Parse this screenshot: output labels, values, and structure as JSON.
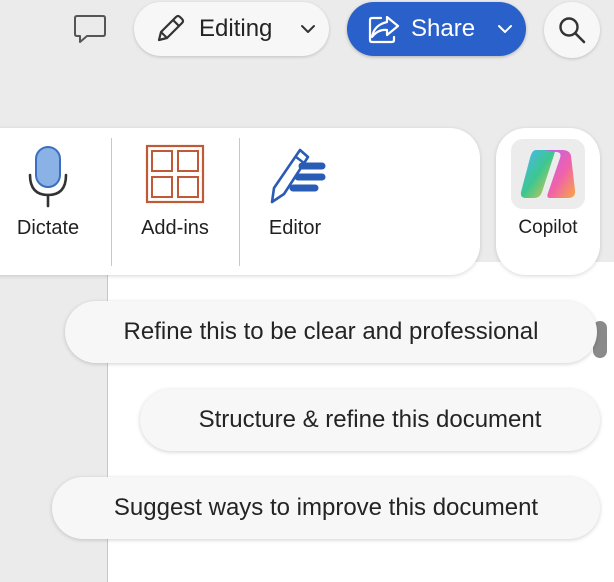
{
  "toolbar": {
    "comment_icon": "comment-icon",
    "editing_label": "Editing",
    "editing_icon": "pencil-icon",
    "share_label": "Share",
    "share_icon": "share-icon",
    "search_icon": "search-icon",
    "accent_color": "#2a60c9"
  },
  "ribbon": {
    "items": [
      {
        "label": "Dictate",
        "icon": "microphone-icon"
      },
      {
        "label": "Add-ins",
        "icon": "add-ins-icon"
      },
      {
        "label": "Editor",
        "icon": "editor-pen-icon"
      }
    ],
    "copilot": {
      "label": "Copilot",
      "icon": "copilot-icon"
    }
  },
  "suggestions": [
    {
      "label": "Refine this to be clear and professional"
    },
    {
      "label": "Structure & refine this document"
    },
    {
      "label": "Suggest ways to improve this document"
    }
  ]
}
